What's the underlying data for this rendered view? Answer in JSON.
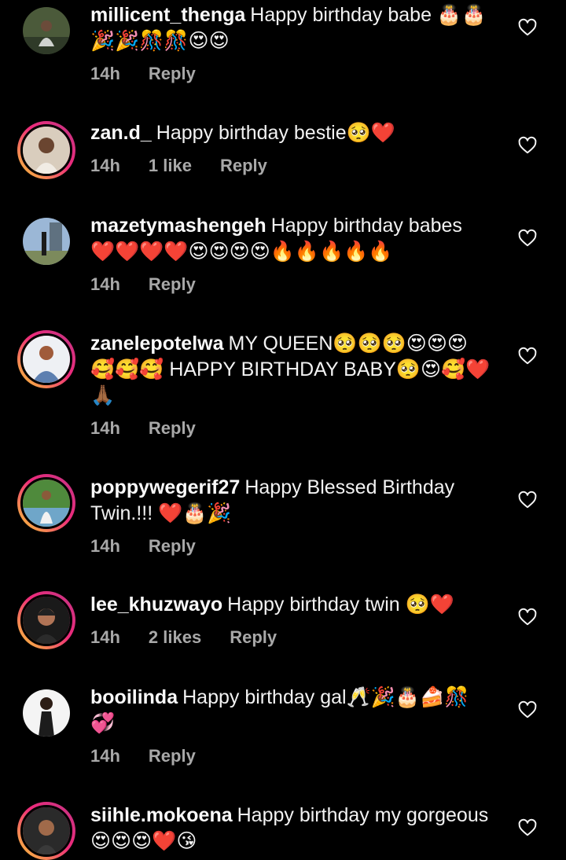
{
  "comments": [
    {
      "username": "millicent_thenga",
      "text": "Happy birthday babe 🎂🎂🎉🎉🎊🎊😍😍",
      "time": "14h",
      "likes": "",
      "reply": "Reply"
    },
    {
      "username": "zan.d_",
      "text": "Happy birthday bestie🥺❤️",
      "time": "14h",
      "likes": "1 like",
      "reply": "Reply"
    },
    {
      "username": "mazetymashengeh",
      "text": "Happy birthday babes ❤️❤️❤️❤️😍😍😍😍🔥🔥🔥🔥🔥",
      "time": "14h",
      "likes": "",
      "reply": "Reply"
    },
    {
      "username": "zanelepotelwa",
      "text": "MY QUEEN🥺🥺🥺😍😍😍🥰🥰🥰 HAPPY BIRTHDAY BABY🥺😍🥰❤️🙏🏾",
      "time": "14h",
      "likes": "",
      "reply": "Reply"
    },
    {
      "username": "poppywegerif27",
      "text": "Happy Blessed Birthday Twin.!!! ❤️🎂🎉",
      "time": "14h",
      "likes": "",
      "reply": "Reply"
    },
    {
      "username": "lee_khuzwayo",
      "text": "Happy birthday twin 🥺❤️",
      "time": "14h",
      "likes": "2 likes",
      "reply": "Reply"
    },
    {
      "username": "booilinda",
      "text": "Happy birthday gal🥂🎉🎂🍰🎊💞",
      "time": "14h",
      "likes": "",
      "reply": "Reply"
    },
    {
      "username": "siihle.mokoena",
      "text": "Happy birthday my gorgeous 😍😍😍❤️😘",
      "time": "",
      "likes": "",
      "reply": ""
    }
  ],
  "icons": {
    "like": "heart-outline-icon"
  },
  "colors": {
    "background": "#000000",
    "text": "#f5f5f5",
    "meta": "#a8a8a8"
  }
}
